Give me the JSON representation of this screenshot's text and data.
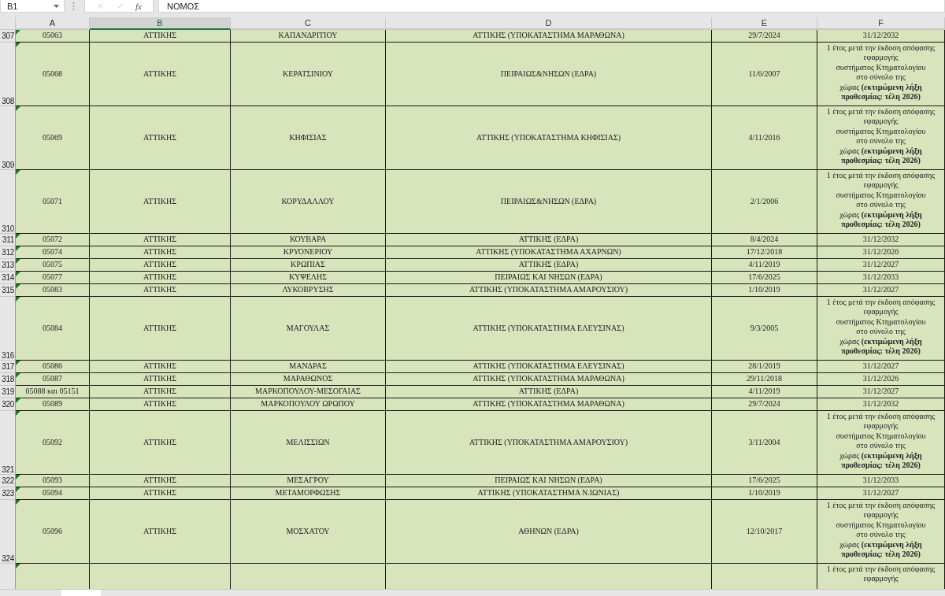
{
  "formula_bar": {
    "name_box": "B1",
    "function_label": "fx",
    "formula": "ΝΟΜΟΣ"
  },
  "columns": [
    {
      "label": "A",
      "selected": false
    },
    {
      "label": "B",
      "selected": true
    },
    {
      "label": "C",
      "selected": false
    },
    {
      "label": "D",
      "selected": false
    },
    {
      "label": "E",
      "selected": false
    },
    {
      "label": "F",
      "selected": false
    }
  ],
  "rows": [
    {
      "number": "307",
      "flag": true,
      "cells": [
        "05063",
        "ΑΤΤΙΚΗΣ",
        "ΚΑΠΑΝΔΡΙΤΙΟΥ",
        "ΑΤΤΙΚΗΣ (ΥΠΟΚΑΤΑΣΤΗΜΑ ΜΑΡΑΘΩΝΑ)",
        "29/7/2024"
      ],
      "f_lines": [
        "31/12/2032"
      ]
    },
    {
      "number": "308",
      "flag": true,
      "cells": [
        "05068",
        "ΑΤΤΙΚΗΣ",
        "ΚΕΡΑΤΣΙΝΙΟΥ",
        "ΠΕΙΡΑΙΩΣ&ΝΗΣΩΝ (ΕΔΡΑ)",
        "11/6/2007"
      ],
      "f_lines": [
        "1 έτος μετά την έκδοση απόφασης",
        "εφαρμογής",
        "συστήματος  Κτηματολογίου",
        "στο σύνολο της",
        "χώρας **(εκτιμώμενη λήξη**",
        "**προθεσμίας: τέλη 2026)**"
      ]
    },
    {
      "number": "309",
      "flag": true,
      "cells": [
        "05069",
        "ΑΤΤΙΚΗΣ",
        "ΚΗΦΙΣΙΑΣ",
        "ΑΤΤΙΚΗΣ (ΥΠΟΚΑΤΑΣΤΗΜΑ ΚΗΦΙΣΙΑΣ)",
        "4/11/2016"
      ],
      "f_lines": [
        "1 έτος μετά την έκδοση απόφασης",
        "εφαρμογής",
        "συστήματος  Κτηματολογίου",
        "στο σύνολο της",
        "χώρας **(εκτιμώμενη λήξη**",
        "**προθεσμίας: τέλη 2026)**"
      ]
    },
    {
      "number": "310",
      "flag": true,
      "cells": [
        "05071",
        "ΑΤΤΙΚΗΣ",
        "ΚΟΡΥΔΑΛΛΟΥ",
        "ΠΕΙΡΑΙΩΣ&ΝΗΣΩΝ (ΕΔΡΑ)",
        "2/1/2006"
      ],
      "f_lines": [
        "1 έτος μετά την έκδοση απόφασης",
        "εφαρμογής",
        "συστήματος  Κτηματολογίου",
        "στο σύνολο της",
        "χώρας **(εκτιμώμενη λήξη**",
        "**προθεσμίας: τέλη 2026)**"
      ]
    },
    {
      "number": "311",
      "flag": true,
      "cells": [
        "05072",
        "ΑΤΤΙΚΗΣ",
        "ΚΟΥΒΑΡΑ",
        "ΑΤΤΙΚΗΣ (ΕΔΡΑ)",
        "8/4/2024"
      ],
      "f_lines": [
        "31/12/2032"
      ]
    },
    {
      "number": "312",
      "flag": true,
      "cells": [
        "05074",
        "ΑΤΤΙΚΗΣ",
        "ΚΡΥΟΝΕΡΙΟΥ",
        "ΑΤΤΙΚΗΣ (ΥΠΟΚΑΤΑΣΤΗΜΑ ΑΧΑΡΝΩΝ)",
        "17/12/2018"
      ],
      "f_lines": [
        "31/12/2026"
      ]
    },
    {
      "number": "313",
      "flag": true,
      "cells": [
        "05075",
        "ΑΤΤΙΚΗΣ",
        "ΚΡΩΠΙΑΣ",
        "ΑΤΤΙΚΗΣ (ΕΔΡΑ)",
        "4/11/2019"
      ],
      "f_lines": [
        "31/12/2027"
      ]
    },
    {
      "number": "314",
      "flag": true,
      "cells": [
        "05077",
        "ΑΤΤΙΚΗΣ",
        "ΚΥΨΕΛΗΣ",
        "ΠΕΙΡΑΙΩΣ ΚΑΙ ΝΗΣΩΝ (ΕΔΡΑ)",
        "17/6/2025"
      ],
      "f_lines": [
        "31/12/2033"
      ]
    },
    {
      "number": "315",
      "flag": true,
      "cells": [
        "05083",
        "ΑΤΤΙΚΗΣ",
        "ΛΥΚΟΒΡΥΣΗΣ",
        "ΑΤΤΙΚΗΣ (ΥΠΟΚΑΤΑΣΤΗΜΑ ΑΜΑΡΟΥΣΙΟΥ)",
        "1/10/2019"
      ],
      "f_lines": [
        "31/12/2027"
      ]
    },
    {
      "number": "316",
      "flag": true,
      "cells": [
        "05084",
        "ΑΤΤΙΚΗΣ",
        "ΜΑΓΟΥΛΑΣ",
        "ΑΤΤΙΚΗΣ (ΥΠΟΚΑΤΑΣΤΗΜΑ ΕΛΕΥΣΙΝΑΣ)",
        "9/3/2005"
      ],
      "f_lines": [
        "1 έτος μετά την έκδοση απόφασης",
        "εφαρμογής",
        "συστήματος  Κτηματολογίου",
        "στο σύνολο της",
        "χώρας **(εκτιμώμενη λήξη**",
        "**προθεσμίας: τέλη 2026)**"
      ]
    },
    {
      "number": "317",
      "flag": true,
      "cells": [
        "05086",
        "ΑΤΤΙΚΗΣ",
        "ΜΑΝΔΡΑΣ",
        "ΑΤΤΙΚΗΣ (ΥΠΟΚΑΤΑΣΤΗΜΑ ΕΛΕΥΣΙΝΑΣ)",
        "28/1/2019"
      ],
      "f_lines": [
        "31/12/2027"
      ]
    },
    {
      "number": "318",
      "flag": true,
      "cells": [
        "05087",
        "ΑΤΤΙΚΗΣ",
        "ΜΑΡΑΘΩΝΟΣ",
        "ΑΤΤΙΚΗΣ (ΥΠΟΚΑΤΑΣΤΗΜΑ ΜΑΡΑΘΩΝΑ)",
        "29/11/2018"
      ],
      "f_lines": [
        "31/12/2026"
      ]
    },
    {
      "number": "319",
      "flag": false,
      "cells": [
        "05088 και 05151",
        "ΑΤΤΙΚΗΣ",
        "ΜΑΡΚΟΠΟΥΛΟΥ-ΜΕΣΟΓΑΙΑΣ",
        "ΑΤΤΙΚΗΣ (ΕΔΡΑ)",
        "4/11/2019"
      ],
      "f_lines": [
        "31/12/2027"
      ]
    },
    {
      "number": "320",
      "flag": true,
      "cells": [
        "05089",
        "ΑΤΤΙΚΗΣ",
        "ΜΑΡΚΟΠΟΥΛΟΥ ΩΡΩΠΟΥ",
        "ΑΤΤΙΚΗΣ (ΥΠΟΚΑΤΑΣΤΗΜΑ ΜΑΡΑΘΩΝΑ)",
        "29/7/2024"
      ],
      "f_lines": [
        "31/12/2032"
      ]
    },
    {
      "number": "321",
      "flag": true,
      "cells": [
        "05092",
        "ΑΤΤΙΚΗΣ",
        "ΜΕΛΙΣΣΙΩΝ",
        "ΑΤΤΙΚΗΣ (ΥΠΟΚΑΤΑΣΤΗΜΑ ΑΜΑΡΟΥΣΙΟΥ)",
        "3/11/2004"
      ],
      "f_lines": [
        "1 έτος μετά την έκδοση απόφασης",
        "εφαρμογής",
        "συστήματος  Κτηματολογίου",
        "στο σύνολο της",
        "χώρας **(εκτιμώμενη λήξη**",
        "**προθεσμίας: τέλη 2026)**"
      ]
    },
    {
      "number": "322",
      "flag": true,
      "cells": [
        "05093",
        "ΑΤΤΙΚΗΣ",
        "ΜΕΣΑΓΡΟΥ",
        "ΠΕΙΡΑΙΩΣ ΚΑΙ ΝΗΣΩΝ (ΕΔΡΑ)",
        "17/6/2025"
      ],
      "f_lines": [
        "31/12/2033"
      ]
    },
    {
      "number": "323",
      "flag": true,
      "cells": [
        "05094",
        "ΑΤΤΙΚΗΣ",
        "ΜΕΤΑΜΟΡΦΩΣΗΣ",
        "ΑΤΤΙΚΗΣ (ΥΠΟΚΑΤΑΣΤΗΜΑ Ν.ΙΩΝΙΑΣ)",
        "1/10/2019"
      ],
      "f_lines": [
        "31/12/2027"
      ]
    },
    {
      "number": "324",
      "flag": true,
      "cells": [
        "05096",
        "ΑΤΤΙΚΗΣ",
        "ΜΟΣΧΑΤΟΥ",
        "ΑΘΗΝΩΝ (ΕΔΡΑ)",
        "12/10/2017"
      ],
      "f_lines": [
        "1 έτος μετά την έκδοση απόφασης",
        "εφαρμογής",
        "συστήματος  Κτηματολογίου",
        "στο σύνολο της",
        "χώρας **(εκτιμώμενη λήξη**",
        "**προθεσμίας: τέλη 2026)**"
      ]
    },
    {
      "flag": true,
      "cells": [
        "",
        "",
        "",
        "",
        ""
      ],
      "f_lines": [
        "1 έτος μετά την έκδοση απόφασης",
        "εφαρμογής"
      ]
    }
  ]
}
